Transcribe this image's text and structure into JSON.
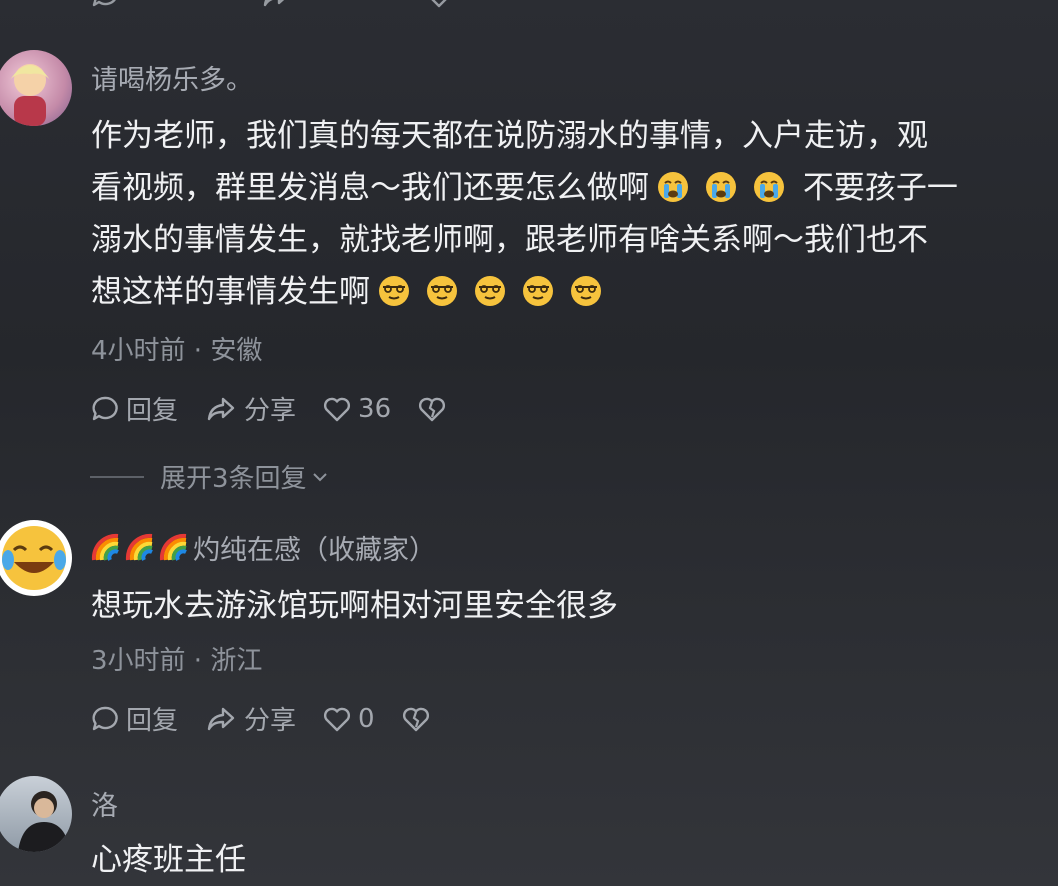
{
  "comments": [
    {
      "username": "请喝杨乐多。",
      "content_lines": [
        "作为老师，我们真的每天都在说防溺水的事情，入户走访，观",
        "看视频，群里发消息～我们还要怎么做啊",
        " 不要孩子一",
        "溺水的事情发生，就找老师啊，跟老师有啥关系啊～我们也不",
        "想这样的事情发生啊"
      ],
      "meta": "4小时前 · 安徽",
      "reply_label": "回复",
      "share_label": "分享",
      "like_count": "36",
      "expand_label": "展开3条回复"
    },
    {
      "username": "灼纯在感（收藏家）",
      "content": "想玩水去游泳馆玩啊相对河里安全很多",
      "meta": "3小时前 · 浙江",
      "reply_label": "回复",
      "share_label": "分享",
      "like_count": "0"
    },
    {
      "username": "洛",
      "content": "心疼班主任"
    }
  ],
  "icons": {
    "reply": "reply-bubble-icon",
    "share": "share-arrow-icon",
    "like": "heart-icon",
    "dislike": "broken-heart-icon",
    "crying": "crying-face-emoji",
    "smirk": "sunglasses-smirk-emoji",
    "rainbow": "rainbow-emoji"
  },
  "colors": {
    "background": "#2a2c31",
    "text": "#f0f1f3",
    "secondary": "#a7abb3",
    "emoji_yellow": "#f6c33d",
    "tear_blue": "#4aa8e8"
  }
}
